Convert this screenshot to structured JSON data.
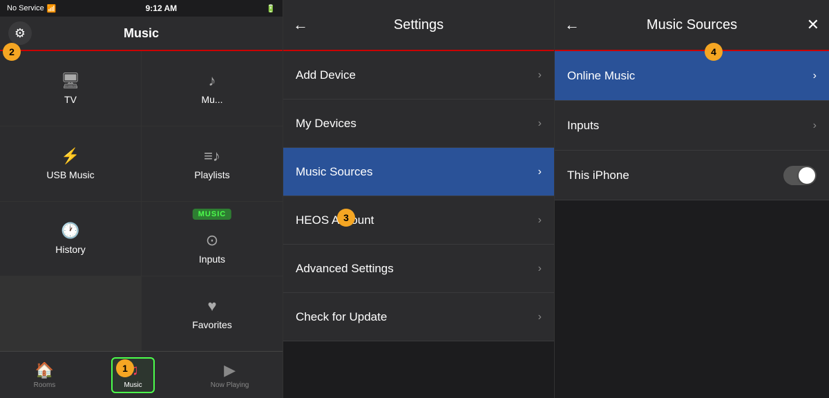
{
  "statusBar": {
    "carrier": "No Service",
    "time": "9:12 AM",
    "battery": "Battery"
  },
  "panelMusic": {
    "title": "Music",
    "gridItems": [
      {
        "id": "tv",
        "icon": "🖥",
        "label": "TV"
      },
      {
        "id": "music",
        "icon": "♪",
        "label": "Mu..."
      },
      {
        "id": "usb",
        "icon": "⚡",
        "label": "USB Music"
      },
      {
        "id": "playlists",
        "icon": "≡♪",
        "label": "Playlists"
      },
      {
        "id": "history",
        "icon": "🕐",
        "label": "History"
      },
      {
        "id": "inputs",
        "icon": "⊙",
        "label": "Inputs"
      },
      {
        "id": "favorites",
        "icon": "♥",
        "label": "Favorites"
      }
    ],
    "musicBadge": "MUSIC",
    "navItems": [
      {
        "id": "rooms",
        "icon": "🏠",
        "label": "Rooms",
        "active": false
      },
      {
        "id": "music",
        "icon": "♫",
        "label": "Music",
        "active": true
      },
      {
        "id": "now-playing",
        "icon": "▶",
        "label": "Now Playing",
        "active": false
      }
    ]
  },
  "panelSettings": {
    "title": "Settings",
    "backIcon": "←",
    "items": [
      {
        "id": "add-device",
        "label": "Add Device",
        "active": false
      },
      {
        "id": "my-devices",
        "label": "My Devices",
        "active": false
      },
      {
        "id": "music-sources",
        "label": "Music Sources",
        "active": true
      },
      {
        "id": "heos-account",
        "label": "HEOS Account",
        "active": false
      },
      {
        "id": "advanced-settings",
        "label": "Advanced Settings",
        "active": false
      },
      {
        "id": "check-update",
        "label": "Check for Update",
        "active": false
      }
    ]
  },
  "panelSources": {
    "title": "Music Sources",
    "backIcon": "←",
    "closeIcon": "✕",
    "items": [
      {
        "id": "online-music",
        "label": "Online Music",
        "active": true,
        "hasChevron": true,
        "hasToggle": false
      },
      {
        "id": "inputs",
        "label": "Inputs",
        "active": false,
        "hasChevron": true,
        "hasToggle": false
      },
      {
        "id": "this-iphone",
        "label": "This iPhone",
        "active": false,
        "hasChevron": false,
        "hasToggle": true,
        "toggleOn": false
      }
    ]
  },
  "stepBadges": {
    "badge1": "1",
    "badge2": "2",
    "badge3": "3",
    "badge4": "4"
  }
}
